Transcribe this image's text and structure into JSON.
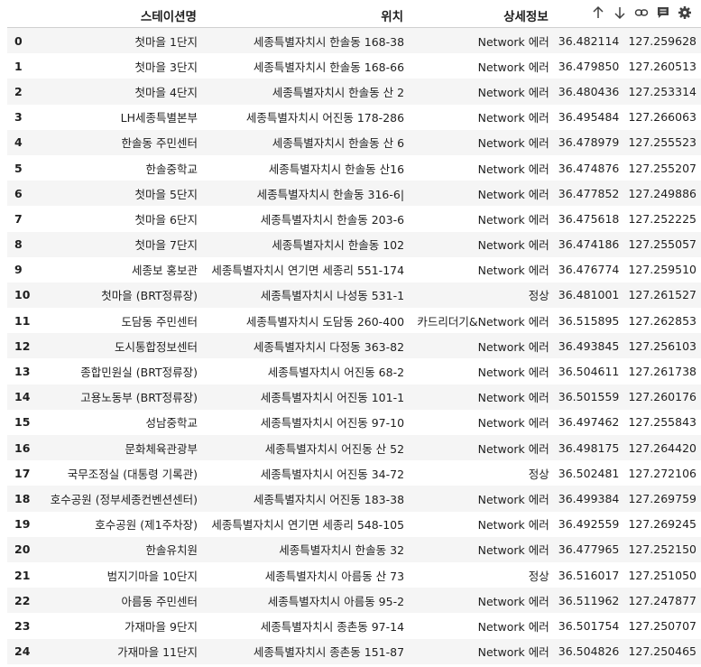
{
  "toolbar": {
    "icons": [
      "arrow-up-icon",
      "arrow-down-icon",
      "link-icon",
      "comment-icon",
      "gear-icon"
    ]
  },
  "table": {
    "columns": [
      "",
      "스테이션명",
      "위치",
      "상세정보",
      "",
      ""
    ],
    "rows": [
      [
        "0",
        "첫마을 1단지",
        "세종특별자치시 한솔동 168-38",
        "Network 에러",
        "36.482114",
        "127.259628"
      ],
      [
        "1",
        "첫마을 3단지",
        "세종특별자치시 한솔동 168-66",
        "Network 에러",
        "36.479850",
        "127.260513"
      ],
      [
        "2",
        "첫마을 4단지",
        "세종특별자치시 한솔동 산 2",
        "Network 에러",
        "36.480436",
        "127.253314"
      ],
      [
        "3",
        "LH세종특별본부",
        "세종특별자치시 어진동 178-286",
        "Network 에러",
        "36.495484",
        "127.266063"
      ],
      [
        "4",
        "한솔동 주민센터",
        "세종특별자치시 한솔동 산 6",
        "Network 에러",
        "36.478979",
        "127.255523"
      ],
      [
        "5",
        "한솔중학교",
        "세종특별자치시 한솔동 산16",
        "Network 에러",
        "36.474876",
        "127.255207"
      ],
      [
        "6",
        "첫마을 5단지",
        "세종특별자치시 한솔동 316-6|",
        "Network 에러",
        "36.477852",
        "127.249886"
      ],
      [
        "7",
        "첫마을 6단지",
        "세종특별자치시 한솔동 203-6",
        "Network 에러",
        "36.475618",
        "127.252225"
      ],
      [
        "8",
        "첫마을 7단지",
        "세종특별자치시 한솔동 102",
        "Network 에러",
        "36.474186",
        "127.255057"
      ],
      [
        "9",
        "세종보 홍보관",
        "세종특별자치시 연기면 세종리 551-174",
        "Network 에러",
        "36.476774",
        "127.259510"
      ],
      [
        "10",
        "첫마을 (BRT정류장)",
        "세종특별자치시 나성동 531-1",
        "정상",
        "36.481001",
        "127.261527"
      ],
      [
        "11",
        "도담동 주민센터",
        "세종특별자치시 도담동 260-400",
        "카드리더기&Network 에러",
        "36.515895",
        "127.262853"
      ],
      [
        "12",
        "도시통합정보센터",
        "세종특별자치시 다정동 363-82",
        "Network 에러",
        "36.493845",
        "127.256103"
      ],
      [
        "13",
        "종합민원실 (BRT정류장)",
        "세종특별자치시 어진동 68-2",
        "Network 에러",
        "36.504611",
        "127.261738"
      ],
      [
        "14",
        "고용노동부 (BRT정류장)",
        "세종특별자치시 어진동 101-1",
        "Network 에러",
        "36.501559",
        "127.260176"
      ],
      [
        "15",
        "성남중학교",
        "세종특별자치시 어진동 97-10",
        "Network 에러",
        "36.497462",
        "127.255843"
      ],
      [
        "16",
        "문화체육관광부",
        "세종특별자치시 어진동 산 52",
        "Network 에러",
        "36.498175",
        "127.264420"
      ],
      [
        "17",
        "국무조정실 (대통령 기록관)",
        "세종특별자치시 어진동 34-72",
        "정상",
        "36.502481",
        "127.272106"
      ],
      [
        "18",
        "호수공원 (정부세종컨벤션센터)",
        "세종특별자치시 어진동 183-38",
        "Network 에러",
        "36.499384",
        "127.269759"
      ],
      [
        "19",
        "호수공원 (제1주차장)",
        "세종특별자치시 연기면 세종리 548-105",
        "Network 에러",
        "36.492559",
        "127.269245"
      ],
      [
        "20",
        "한솔유치원",
        "세종특별자치시 한솔동 32",
        "Network 에러",
        "36.477965",
        "127.252150"
      ],
      [
        "21",
        "범지기마을 10단지",
        "세종특별자치시 아름동 산 73",
        "정상",
        "36.516017",
        "127.251050"
      ],
      [
        "22",
        "아름동 주민센터",
        "세종특별자치시 아름동 95-2",
        "Network 에러",
        "36.511962",
        "127.247877"
      ],
      [
        "23",
        "가재마을 9단지",
        "세종특별자치시 종촌동 97-14",
        "Network 에러",
        "36.501754",
        "127.250707"
      ],
      [
        "24",
        "가재마을 11단지",
        "세종특별자치시 종촌동 151-87",
        "Network 에러",
        "36.504826",
        "127.250465"
      ]
    ]
  }
}
